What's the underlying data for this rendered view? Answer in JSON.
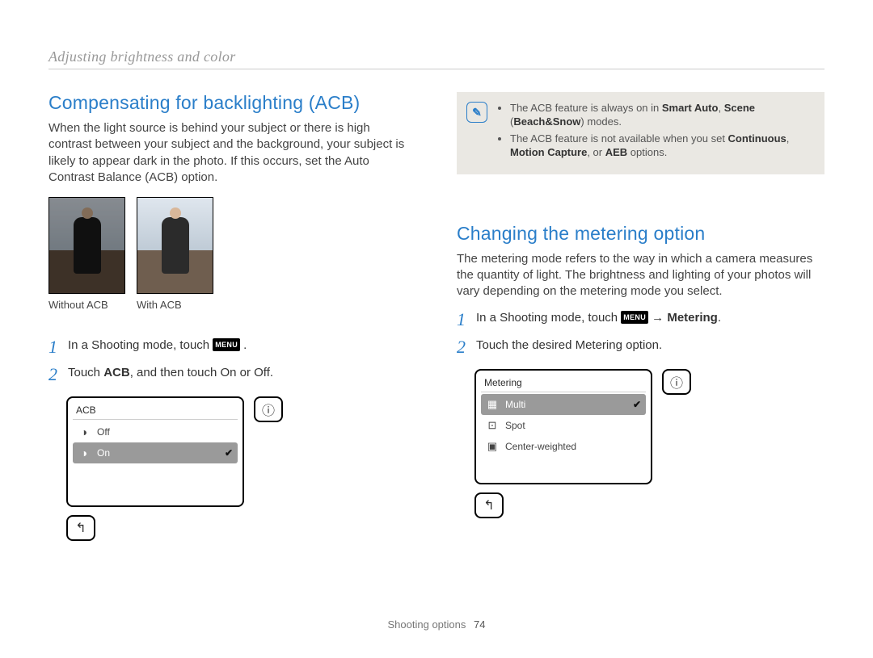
{
  "breadcrumb": "Adjusting brightness and color",
  "left": {
    "heading": "Compensating for backlighting (ACB)",
    "body": "When the light source is behind your subject or there is high contrast between your subject and the background, your subject is likely to appear dark in the photo. If this occurs, set the Auto Contrast Balance (ACB) option.",
    "caption_without": "Without ACB",
    "caption_with": "With ACB",
    "step1_pre": "In a Shooting mode, touch ",
    "menu_chip": "MENU",
    "step1_post": " .",
    "step2_pre": "Touch ",
    "step2_bold": "ACB",
    "step2_post": ", and then touch On or Off.",
    "panel": {
      "title": "ACB",
      "off": "Off",
      "on": "On"
    }
  },
  "right": {
    "note_items": [
      {
        "pre": "The ACB feature is always on in ",
        "b1": "Smart Auto",
        "sep1": ", ",
        "b2": "Scene",
        "sep2": " (",
        "b3": "Beach&Snow",
        "post": ") modes."
      },
      {
        "pre": "The ACB feature is not available when you set ",
        "b1": "Continuous",
        "sep1": ", ",
        "b2": "Motion Capture",
        "sep2": ", or ",
        "b3": "AEB",
        "post": " options."
      }
    ],
    "heading": "Changing the metering option",
    "body": "The metering mode refers to the way in which a camera measures the quantity of light. The brightness and lighting of your photos will vary depending on the metering mode you select.",
    "step1_pre": "In a Shooting mode, touch ",
    "menu_chip": "MENU",
    "step1_arrow": " → ",
    "step1_bold": "Metering",
    "step1_post": ".",
    "step2": "Touch the desired Metering option.",
    "panel": {
      "title": "Metering",
      "multi": "Multi",
      "spot": "Spot",
      "center": "Center-weighted"
    }
  },
  "footer_label": "Shooting options",
  "footer_page": "74",
  "numbers": {
    "one": "1",
    "two": "2"
  },
  "glyphs": {
    "info": "ⓘ",
    "back": "↰",
    "check": "✔",
    "note": "✎"
  }
}
